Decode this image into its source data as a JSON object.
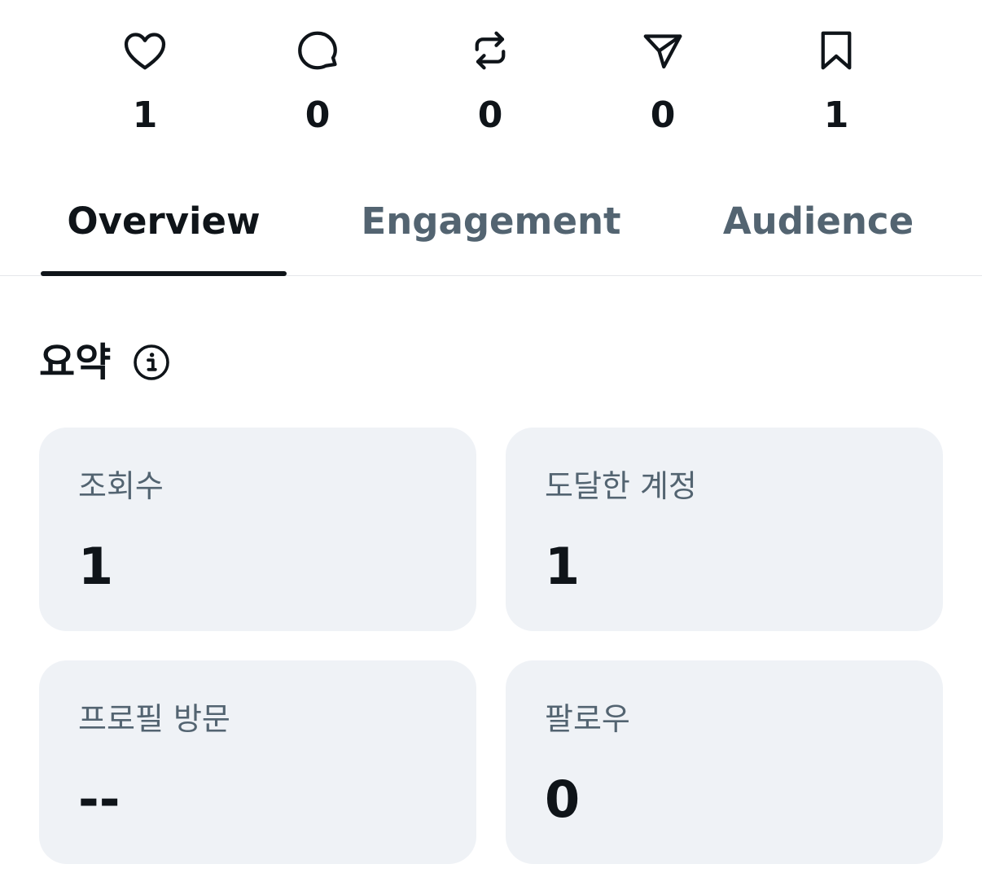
{
  "stats": [
    {
      "icon": "heart-icon",
      "count": "1"
    },
    {
      "icon": "comment-icon",
      "count": "0"
    },
    {
      "icon": "repost-icon",
      "count": "0"
    },
    {
      "icon": "share-icon",
      "count": "0"
    },
    {
      "icon": "bookmark-icon",
      "count": "1"
    }
  ],
  "tabs": [
    {
      "label": "Overview",
      "active": true
    },
    {
      "label": "Engagement",
      "active": false
    },
    {
      "label": "Audience",
      "active": false
    }
  ],
  "summary": {
    "title": "요약",
    "info_icon": "info-icon"
  },
  "cards": [
    {
      "label": "조회수",
      "value": "1"
    },
    {
      "label": "도달한 계정",
      "value": "1"
    },
    {
      "label": "프로필 방문",
      "value": "--"
    },
    {
      "label": "팔로우",
      "value": "0"
    }
  ],
  "colors": {
    "text_primary": "#0f1419",
    "text_secondary": "#536471",
    "card_background": "#eff2f6",
    "divider": "#e5e7ea"
  }
}
